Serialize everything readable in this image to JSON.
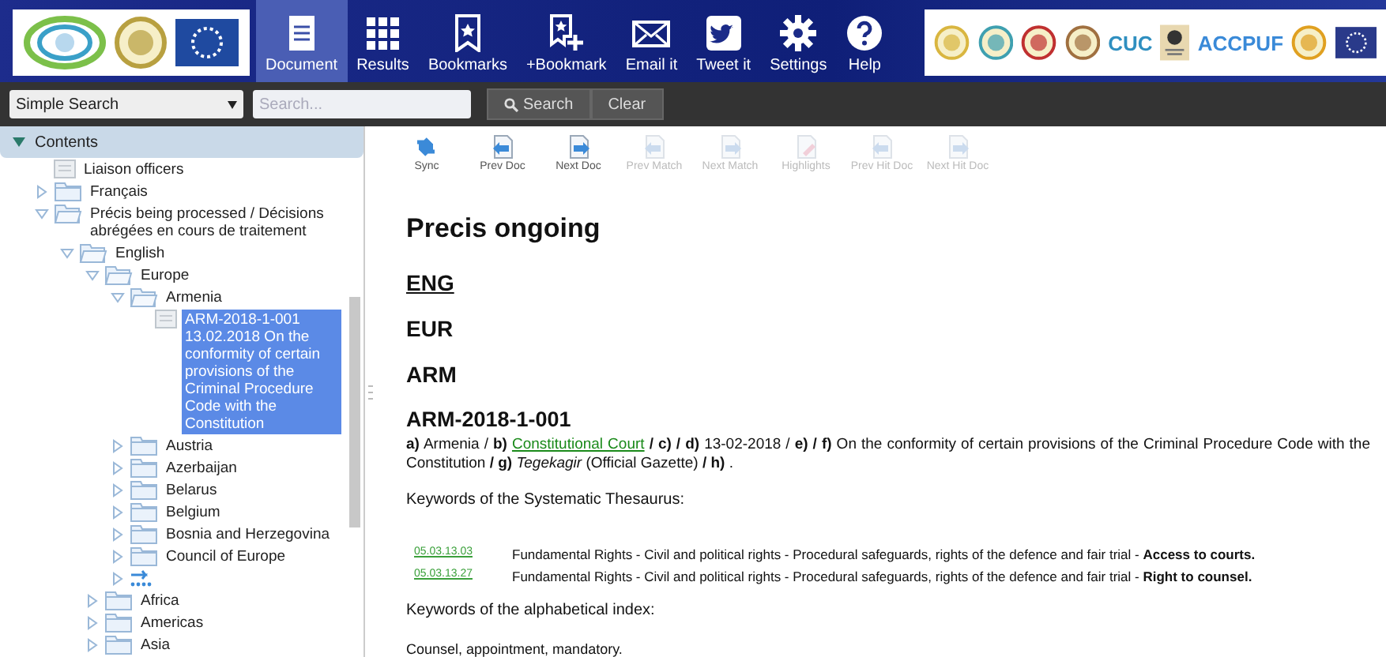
{
  "header": {
    "site_logos": [
      {
        "kind": "ring",
        "color": "#7cc04a"
      },
      {
        "kind": "emblem",
        "color": "#b8a040"
      },
      {
        "kind": "flag",
        "color": "#1f4aa0"
      }
    ],
    "toolbar": [
      {
        "label": "Document",
        "selected": true
      },
      {
        "label": "Results",
        "selected": false
      },
      {
        "label": "Bookmarks",
        "selected": false
      },
      {
        "label": "+Bookmark",
        "selected": false
      },
      {
        "label": "Email it",
        "selected": false
      },
      {
        "label": "Tweet it",
        "selected": false
      },
      {
        "label": "Settings",
        "selected": false
      },
      {
        "label": "Help",
        "selected": false
      }
    ],
    "partner_logos": [
      {
        "kind": "emblem",
        "color": "#d9b640"
      },
      {
        "kind": "emblem",
        "color": "#3fa0b0"
      },
      {
        "kind": "emblem",
        "color": "#c03030"
      },
      {
        "kind": "emblem",
        "color": "#a07040"
      },
      {
        "kind": "wordmark",
        "text": "CUC",
        "color": "#2f8fc0"
      },
      {
        "kind": "badge",
        "color": "#e8d8b0"
      },
      {
        "kind": "wordmark",
        "text": "ACCPUF",
        "color": "#3a8ad8"
      },
      {
        "kind": "emblem",
        "color": "#e0a020"
      },
      {
        "kind": "flag",
        "color": "#2a3a8a"
      }
    ]
  },
  "search": {
    "mode": "Simple Search",
    "placeholder": "Search...",
    "buttons": [
      "Search",
      "Clear"
    ]
  },
  "contents": {
    "title": "Contents",
    "expanded": true,
    "items": [
      {
        "label": "Liaison officers",
        "kind": "doc",
        "selected": false
      },
      {
        "label": "Français",
        "kind": "folder",
        "expanded": false,
        "selected": false
      },
      {
        "label": "Précis being processed / Décisions abrégées en cours de traitement",
        "kind": "folder",
        "expanded": true,
        "selected": false,
        "children": [
          {
            "label": "English",
            "kind": "folder",
            "expanded": true,
            "selected": false,
            "children": [
              {
                "label": "Europe",
                "kind": "folder",
                "expanded": true,
                "selected": false,
                "children": [
                  {
                    "label": "Armenia",
                    "kind": "folder",
                    "expanded": true,
                    "selected": false,
                    "children": [
                      {
                        "label": "ARM-2018-1-001 13.02.2018 On the conformity of certain provisions of the Criminal Procedure Code with the Constitution",
                        "kind": "doc",
                        "selected": true
                      }
                    ]
                  },
                  {
                    "label": "Austria",
                    "kind": "folder",
                    "expanded": false,
                    "selected": false
                  },
                  {
                    "label": "Azerbaijan",
                    "kind": "folder",
                    "expanded": false,
                    "selected": false
                  },
                  {
                    "label": "Belarus",
                    "kind": "folder",
                    "expanded": false,
                    "selected": false
                  },
                  {
                    "label": "Belgium",
                    "kind": "folder",
                    "expanded": false,
                    "selected": false
                  },
                  {
                    "label": "Bosnia and Herzegovina",
                    "kind": "folder",
                    "expanded": false,
                    "selected": false
                  },
                  {
                    "label": "Council of Europe",
                    "kind": "folder",
                    "expanded": false,
                    "selected": false
                  },
                  {
                    "kind": "more",
                    "expanded": false,
                    "selected": false
                  }
                ]
              },
              {
                "label": "Africa",
                "kind": "folder",
                "expanded": false,
                "selected": false
              },
              {
                "label": "Americas",
                "kind": "folder",
                "expanded": false,
                "selected": false
              },
              {
                "label": "Asia",
                "kind": "folder",
                "expanded": false,
                "selected": false
              }
            ]
          }
        ]
      }
    ]
  },
  "doc_toolbar": [
    {
      "label": "Sync",
      "disabled": false
    },
    {
      "label": "Prev Doc",
      "disabled": false
    },
    {
      "label": "Next Doc",
      "disabled": false
    },
    {
      "label": "Prev Match",
      "disabled": true
    },
    {
      "label": "Next Match",
      "disabled": true
    },
    {
      "label": "Highlights",
      "disabled": true
    },
    {
      "label": "Prev Hit Doc",
      "disabled": true
    },
    {
      "label": "Next Hit Doc",
      "disabled": true
    }
  ],
  "document": {
    "title": "Precis ongoing",
    "language": "ENG",
    "region": "EUR",
    "country": "ARM",
    "reference": "ARM-2018-1-001",
    "metadata": [
      {
        "kind": "text",
        "text": "**a)**  Armenia / **b)** "
      },
      {
        "kind": "link",
        "text": "Constitutional Court"
      },
      {
        "kind": "text",
        "text": " **/ c) / d)**  13-02-2018 / **e) / f)**  On the conformity of certain provisions of the Criminal Procedure Code with the Constitution **/ g)** *Tegekagir* (Official Gazette) **/ h)** ."
      }
    ],
    "thesaurus_heading": "Keywords of the Systematic Thesaurus:",
    "keywords": [
      {
        "code": "05.03.13.03",
        "text": "Fundamental Rights - Civil and political rights - Procedural safeguards, rights of the defence and fair trial - **Access to courts.**"
      },
      {
        "code": "05.03.13.27",
        "text": "Fundamental Rights - Civil and political rights - Procedural safeguards, rights of the defence and fair trial - **Right to counsel.**"
      }
    ],
    "index_heading": "Keywords of the alphabetical index:",
    "index_text": "Counsel, appointment, mandatory."
  }
}
